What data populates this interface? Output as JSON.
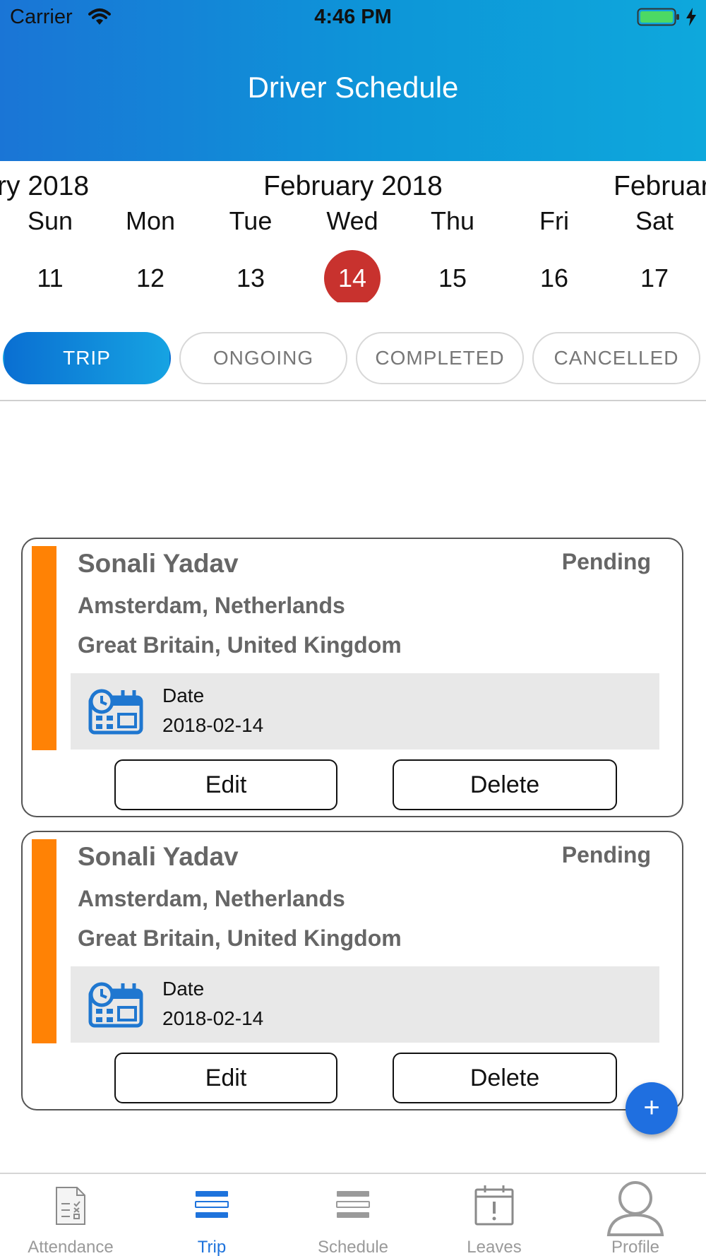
{
  "status_bar": {
    "carrier": "Carrier",
    "time": "4:46 PM"
  },
  "header": {
    "title": "Driver Schedule"
  },
  "calendar": {
    "prev_month_partial": "ry 2018",
    "current_month": "February 2018",
    "next_month_partial": "Februar",
    "days": [
      {
        "name": "Sun",
        "num": "11"
      },
      {
        "name": "Mon",
        "num": "12"
      },
      {
        "name": "Tue",
        "num": "13"
      },
      {
        "name": "Wed",
        "num": "14"
      },
      {
        "name": "Thu",
        "num": "15"
      },
      {
        "name": "Fri",
        "num": "16"
      },
      {
        "name": "Sat",
        "num": "17"
      }
    ],
    "selected_day": "14"
  },
  "tabs": [
    {
      "label": "TRIP",
      "active": true
    },
    {
      "label": "ONGOING",
      "active": false
    },
    {
      "label": "COMPLETED",
      "active": false
    },
    {
      "label": "CANCELLED",
      "active": false
    }
  ],
  "trips": [
    {
      "name": "Sonali Yadav",
      "status": "Pending",
      "from": "Amsterdam, Netherlands",
      "to": "Great Britain, United Kingdom",
      "date_label": "Date",
      "date": "2018-02-14",
      "edit_label": "Edit",
      "delete_label": "Delete"
    },
    {
      "name": "Sonali Yadav",
      "status": "Pending",
      "from": "Amsterdam, Netherlands",
      "to": "Great Britain, United Kingdom",
      "date_label": "Date",
      "date": "2018-02-14",
      "edit_label": "Edit",
      "delete_label": "Delete"
    }
  ],
  "fab": {
    "label": "+"
  },
  "tab_bar": [
    {
      "label": "Attendance",
      "icon": "attendance-icon",
      "active": false
    },
    {
      "label": "Trip",
      "icon": "trip-icon",
      "active": true
    },
    {
      "label": "Schedule",
      "icon": "schedule-icon",
      "active": false
    },
    {
      "label": "Leaves",
      "icon": "leaves-icon",
      "active": false
    },
    {
      "label": "Profile",
      "icon": "profile-icon",
      "active": false
    }
  ],
  "colors": {
    "header_start": "#1a75d6",
    "header_end": "#0ea8dc",
    "selected_day": "#c8322e",
    "card_stripe": "#ff8205",
    "active_tab_blue": "#1e73dc",
    "fab": "#1f6fe0"
  }
}
